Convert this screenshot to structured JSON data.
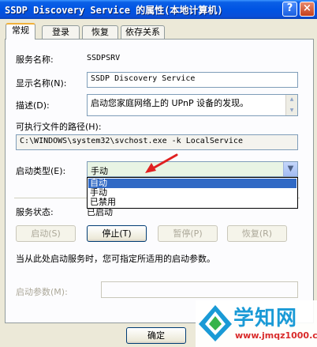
{
  "window": {
    "title": "SSDP Discovery Service 的属性(本地计算机)",
    "help_label": "?",
    "close_label": "×"
  },
  "tabs": [
    {
      "label": "常规",
      "active": true
    },
    {
      "label": "登录",
      "active": false
    },
    {
      "label": "恢复",
      "active": false
    },
    {
      "label": "依存关系",
      "active": false
    }
  ],
  "general": {
    "service_name_label": "服务名称:",
    "service_name_value": "SSDPSRV",
    "display_name_label": "显示名称(N):",
    "display_name_value": "SSDP Discovery Service",
    "description_label": "描述(D):",
    "description_value": "启动您家庭网络上的 UPnP 设备的发现。",
    "exe_path_label": "可执行文件的路径(H):",
    "exe_path_value": "C:\\WINDOWS\\system32\\svchost.exe -k LocalService",
    "startup_type_label": "启动类型(E):",
    "startup_type_value": "手动",
    "startup_options": [
      "自动",
      "手动",
      "已禁用"
    ],
    "highlighted_option": 0,
    "service_status_label": "服务状态:",
    "service_status_value": "已启动",
    "note": "当从此处启动服务时，您可指定所适用的启动参数。",
    "start_params_label": "启动参数(M):",
    "start_params_value": ""
  },
  "buttons": {
    "start": "启动(S)",
    "stop": "停止(T)",
    "pause": "暂停(P)",
    "resume": "恢复(R)",
    "ok": "确定"
  },
  "watermark": {
    "main": "学知网",
    "url": "www.jmqz1000.com"
  },
  "colors": {
    "titlebar": "#0054e3",
    "tab_accent": "#f1b13a",
    "highlight": "#316ac5",
    "arrow": "#e02020"
  }
}
